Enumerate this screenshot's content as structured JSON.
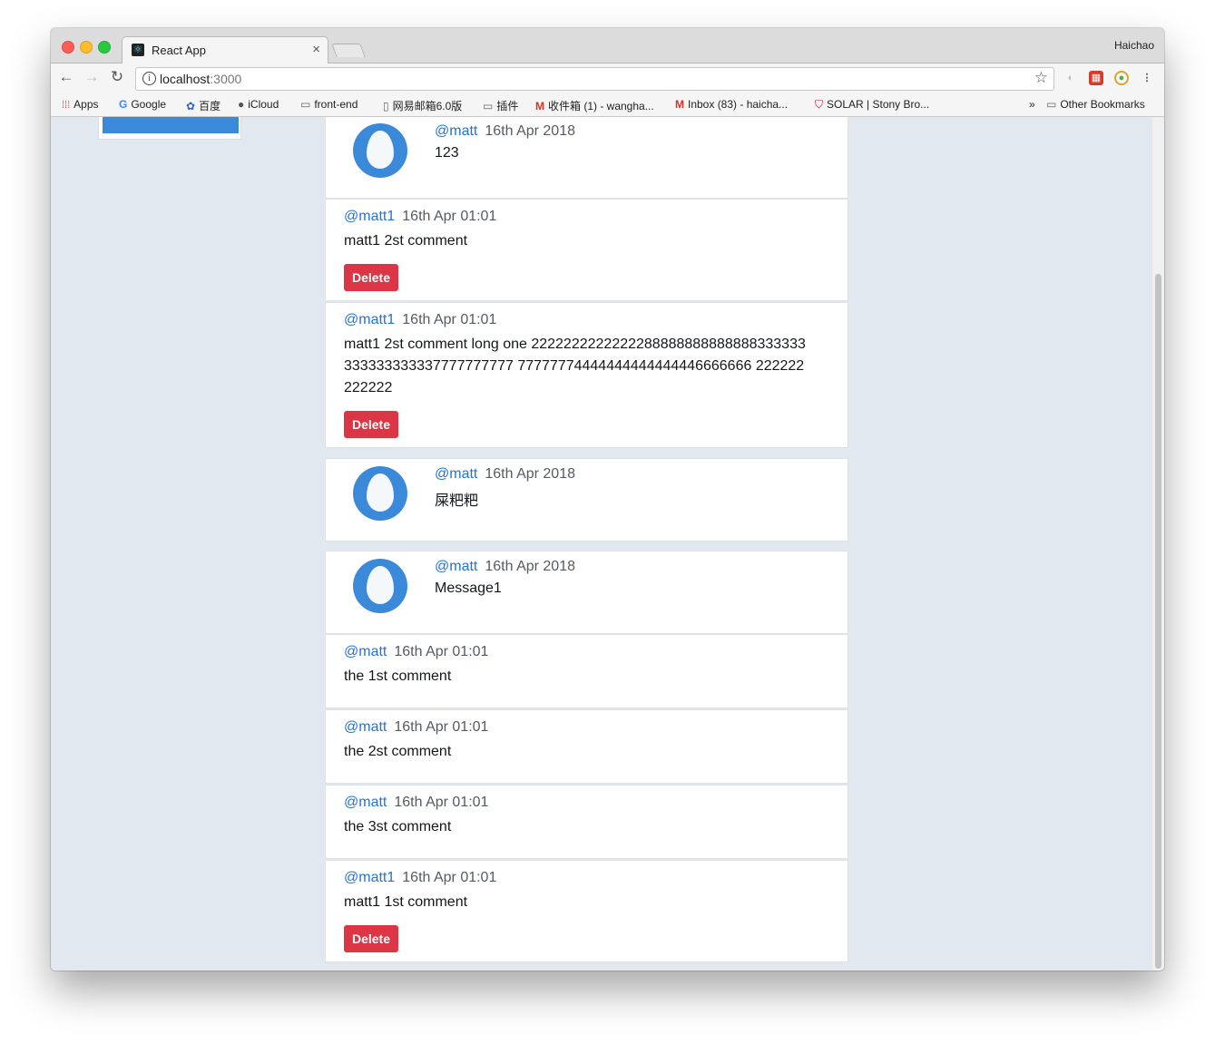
{
  "browser": {
    "tab_title": "React App",
    "tab_favicon": "react-icon",
    "profile_name": "Haichao",
    "url_host": "localhost",
    "url_port": ":3000",
    "bookmarks": [
      {
        "label": "Apps",
        "icon": "apps-grid-icon"
      },
      {
        "label": "Google",
        "icon": "google-icon"
      },
      {
        "label": "百度",
        "icon": "baidu-icon"
      },
      {
        "label": "iCloud",
        "icon": "apple-icon"
      },
      {
        "label": "front-end",
        "icon": "folder-icon"
      },
      {
        "label": "网易邮箱6.0版",
        "icon": "page-icon"
      },
      {
        "label": "插件",
        "icon": "folder-icon"
      },
      {
        "label": "收件箱 (1) - wangha...",
        "icon": "gmail-icon"
      },
      {
        "label": "Inbox (83) - haicha...",
        "icon": "gmail-icon"
      },
      {
        "label": "SOLAR | Stony Bro...",
        "icon": "shield-icon"
      }
    ],
    "overflow_label": "»",
    "other_bookmarks": "Other Bookmarks"
  },
  "feed": [
    {
      "type": "message",
      "handle": "@matt",
      "date": "16th Apr 2018",
      "text": "123"
    },
    {
      "type": "comment",
      "handle": "@matt1",
      "date": "16th Apr 01:01",
      "text": "matt1 2st comment",
      "delete_label": "Delete"
    },
    {
      "type": "comment",
      "handle": "@matt1",
      "date": "16th Apr 01:01",
      "text": "matt1 2st comment long one 2222222222222288888888888888333333333333333337777777777 77777774444444444444446666666 222222222222",
      "delete_label": "Delete"
    },
    {
      "type": "message",
      "handle": "@matt",
      "date": "16th Apr 2018",
      "text": "屎粑粑"
    },
    {
      "type": "message",
      "handle": "@matt",
      "date": "16th Apr 2018",
      "text": "Message1"
    },
    {
      "type": "comment",
      "handle": "@matt",
      "date": "16th Apr 01:01",
      "text": "the 1st comment"
    },
    {
      "type": "comment",
      "handle": "@matt",
      "date": "16th Apr 01:01",
      "text": "the 2st comment"
    },
    {
      "type": "comment",
      "handle": "@matt",
      "date": "16th Apr 01:01",
      "text": "the 3st comment"
    },
    {
      "type": "comment",
      "handle": "@matt1",
      "date": "16th Apr 01:01",
      "text": "matt1 1st comment",
      "delete_label": "Delete"
    }
  ],
  "colors": {
    "accent": "#2173d9",
    "delete": "#dc3545",
    "avatar": "#3b8ad9",
    "page_bg": "#e1e8ef"
  }
}
